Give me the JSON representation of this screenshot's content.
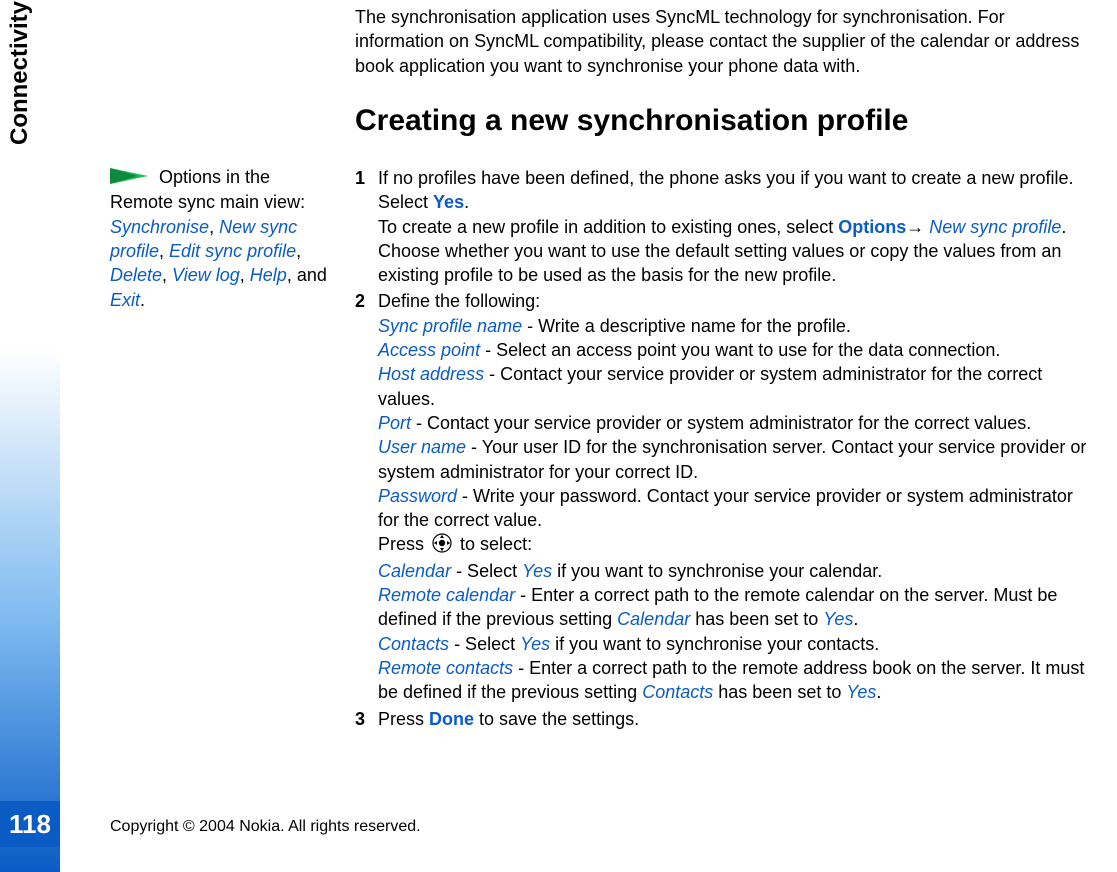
{
  "chapter": "Connectivity",
  "page_number": "118",
  "copyright": "Copyright © 2004 Nokia. All rights reserved.",
  "intro": "The synchronisation application uses SyncML technology for synchronisation. For information on SyncML compatibility, please contact the supplier of the calendar or address book application you want to synchronise your phone data with.",
  "h2": "Creating a new synchronisation profile",
  "sidebar": {
    "lead": " Options in the Remote sync main view: ",
    "opt1": "Synchronise",
    "opt2": "New sync profile",
    "opt3": "Edit sync profile",
    "opt4": "Delete",
    "opt5": "View log",
    "opt6": "Help",
    "tail": ", and ",
    "opt7": "Exit",
    "end": "."
  },
  "steps": {
    "s1": {
      "num": "1",
      "a1": "If no profiles have been defined, the phone asks you if you want to create a new profile. Select ",
      "yes": "Yes",
      "a2": ".",
      "b1": "To create a new profile in addition to existing ones, select ",
      "options": "Options",
      "arrow": "→ ",
      "newsync": "New sync profile",
      "b2": ". Choose whether you want to use the default setting values or copy the values from an existing profile to be used as the basis for the new profile."
    },
    "s2": {
      "num": "2",
      "head": "Define the following:",
      "spn": "Sync profile name",
      "spn_t": " - Write a descriptive name for the profile.",
      "ap": "Access point",
      "ap_t": " - Select an access point you want to use for the data connection.",
      "ha": "Host address",
      "ha_t": " - Contact your service provider or system administrator for the correct values.",
      "po": "Port",
      "po_t": " - Contact your service provider or system administrator for the correct values.",
      "un": "User name",
      "un_t": " - Your user ID for the synchronisation server. Contact your service provider or system administrator for your correct ID.",
      "pw": "Password",
      "pw_t": " - Write your password. Contact your service provider or system administrator for the correct value.",
      "press_a": "Press ",
      "press_b": " to select:",
      "cal": "Calendar",
      "cal_t1": " - Select ",
      "cal_yes": "Yes",
      "cal_t2": " if you want to synchronise your calendar.",
      "rcal": "Remote calendar",
      "rcal_t1": " - Enter a correct path to the remote calendar on the server. Must be defined if the previous setting ",
      "rcal_cal": "Calendar",
      "rcal_t2": " has been set to ",
      "rcal_yes": "Yes",
      "rcal_t3": ".",
      "con": "Contacts",
      "con_t1": " - Select ",
      "con_yes": "Yes",
      "con_t2": " if you want to synchronise your contacts.",
      "rcon": "Remote contacts",
      "rcon_t1": " - Enter a correct path to the remote address book on the server. It must be defined if the previous setting ",
      "rcon_con": "Contacts",
      "rcon_t2": " has been set to ",
      "rcon_yes": "Yes",
      "rcon_t3": "."
    },
    "s3": {
      "num": "3",
      "a": "Press ",
      "done": "Done",
      "b": " to save the settings."
    }
  }
}
